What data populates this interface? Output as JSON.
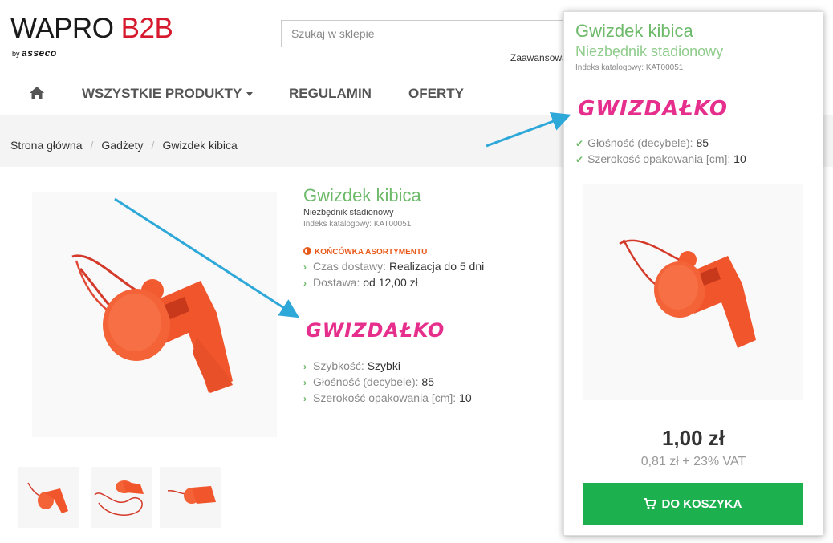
{
  "header": {
    "logo_wapro": "WAPRO",
    "logo_b2b": "B2B",
    "logo_by": "by",
    "logo_asseco": "asseco",
    "search_placeholder": "Szukaj w sklepie",
    "advanced_search": "Zaawansowa"
  },
  "nav": {
    "home_icon": "home-icon",
    "items": [
      {
        "label": "WSZYSTKIE PRODUKTY"
      },
      {
        "label": "REGULAMIN"
      },
      {
        "label": "OFERTY"
      }
    ]
  },
  "breadcrumb": [
    "Strona główna",
    "Gadżety",
    "Gwizdek kibica"
  ],
  "product": {
    "title": "Gwizdek kibica",
    "subtitle": "Niezbędnik stadionowy",
    "catalog_index": "Indeks katalogowy: KAT00051",
    "end_of_range": "KOŃCÓWKA ASORTYMENTU",
    "delivery": [
      {
        "key": "Czas dostawy:",
        "value": "Realizacja do 5 dni"
      },
      {
        "key": "Dostawa:",
        "value": "od 12,00 zł"
      }
    ],
    "brand": "GWIZDAŁKO",
    "attributes": [
      {
        "key": "Szybkość:",
        "value": "Szybki"
      },
      {
        "key": "Głośność (decybele):",
        "value": "85"
      },
      {
        "key": "Szerokość opakowania [cm]:",
        "value": "10"
      }
    ]
  },
  "card": {
    "title": "Gwizdek kibica",
    "subtitle": "Niezbędnik stadionowy",
    "catalog_index": "Indeks katalogowy: KAT00051",
    "brand": "GWIZDAŁKO",
    "attributes": [
      {
        "key": "Głośność (decybele):",
        "value": "85"
      },
      {
        "key": "Szerokość opakowania [cm]:",
        "value": "10"
      }
    ],
    "price": "1,00 zł",
    "net_price": "0,81 zł + 23% VAT",
    "add_to_cart": "DO KOSZYKA"
  },
  "colors": {
    "brand_red": "#d7192e",
    "title_green": "#6dba6a",
    "cart_green": "#1db04f",
    "warning_orange": "#e8591a",
    "brand_pink": "#e62f8d",
    "annotation_blue": "#2ea8d9"
  }
}
